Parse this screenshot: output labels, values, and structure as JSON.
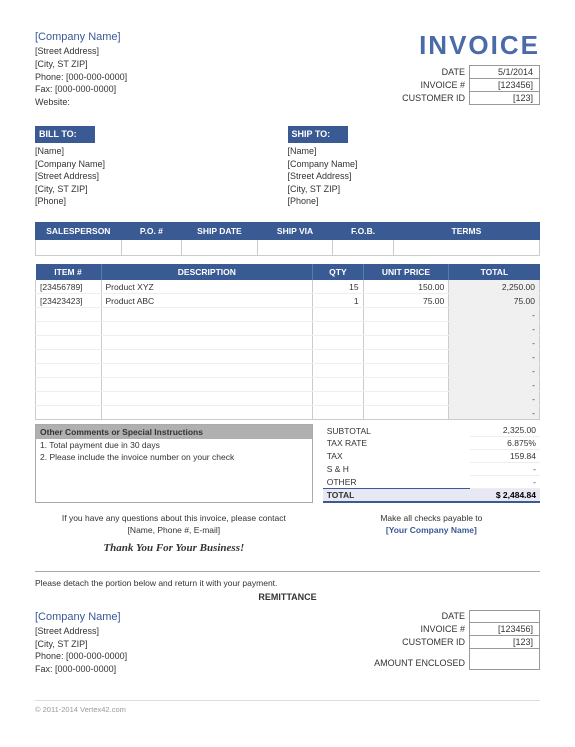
{
  "company": {
    "name": "[Company Name]",
    "street": "[Street Address]",
    "city": "[City, ST  ZIP]",
    "phone_label": "Phone:",
    "phone": "[000-000-0000]",
    "fax_label": "Fax:",
    "fax": "[000-000-0000]",
    "website_label": "Website:"
  },
  "invoice_title": "INVOICE",
  "meta": {
    "date_label": "DATE",
    "date": "5/1/2014",
    "invoice_num_label": "INVOICE #",
    "invoice_num": "[123456]",
    "customer_id_label": "CUSTOMER ID",
    "customer_id": "[123]"
  },
  "bill_to": {
    "header": "BILL TO:",
    "name": "[Name]",
    "company": "[Company Name]",
    "street": "[Street Address]",
    "city": "[City, ST  ZIP]",
    "phone": "[Phone]"
  },
  "ship_to": {
    "header": "SHIP TO:",
    "name": "[Name]",
    "company": "[Company Name]",
    "street": "[Street Address]",
    "city": "[City, ST  ZIP]",
    "phone": "[Phone]"
  },
  "details_headers": {
    "salesperson": "SALESPERSON",
    "po": "P.O. #",
    "ship_date": "SHIP DATE",
    "ship_via": "SHIP VIA",
    "fob": "F.O.B.",
    "terms": "TERMS"
  },
  "items_headers": {
    "item": "ITEM #",
    "description": "DESCRIPTION",
    "qty": "QTY",
    "unit_price": "UNIT PRICE",
    "total": "TOTAL"
  },
  "items": [
    {
      "item": "[23456789]",
      "description": "Product XYZ",
      "qty": "15",
      "unit_price": "150.00",
      "total": "2,250.00"
    },
    {
      "item": "[23423423]",
      "description": "Product ABC",
      "qty": "1",
      "unit_price": "75.00",
      "total": "75.00"
    }
  ],
  "empty_total": "-",
  "comments": {
    "header": "Other Comments or Special Instructions",
    "line1": "1. Total payment due in 30 days",
    "line2": "2. Please include the invoice number on your check"
  },
  "totals": {
    "subtotal_label": "SUBTOTAL",
    "subtotal": "2,325.00",
    "tax_rate_label": "TAX RATE",
    "tax_rate": "6.875%",
    "tax_label": "TAX",
    "tax": "159.84",
    "sh_label": "S & H",
    "sh": "-",
    "other_label": "OTHER",
    "other": "-",
    "grand_label": "TOTAL",
    "grand": "$      2,484.84"
  },
  "contact": {
    "line1": "If you have any questions about this invoice, please contact",
    "line2": "[Name, Phone #, E-mail]",
    "thank_you": "Thank You For Your Business!"
  },
  "payable": {
    "line1": "Make all checks payable to",
    "name": "[Your Company Name]"
  },
  "detach": "Please detach the portion below and return it with your payment.",
  "remittance_title": "REMITTANCE",
  "remit_company": {
    "name": "[Company Name]",
    "street": "[Street Address]",
    "city": "[City, ST  ZIP]",
    "phone_label": "Phone:",
    "phone": "[000-000-0000]",
    "fax_label": "Fax:",
    "fax": "[000-000-0000]"
  },
  "remit_meta": {
    "date_label": "DATE",
    "date": "",
    "invoice_num_label": "INVOICE #",
    "invoice_num": "[123456]",
    "customer_id_label": "CUSTOMER ID",
    "customer_id": "[123]",
    "amount_label": "AMOUNT ENCLOSED",
    "amount": ""
  },
  "footer": "© 2011-2014 Vertex42.com"
}
